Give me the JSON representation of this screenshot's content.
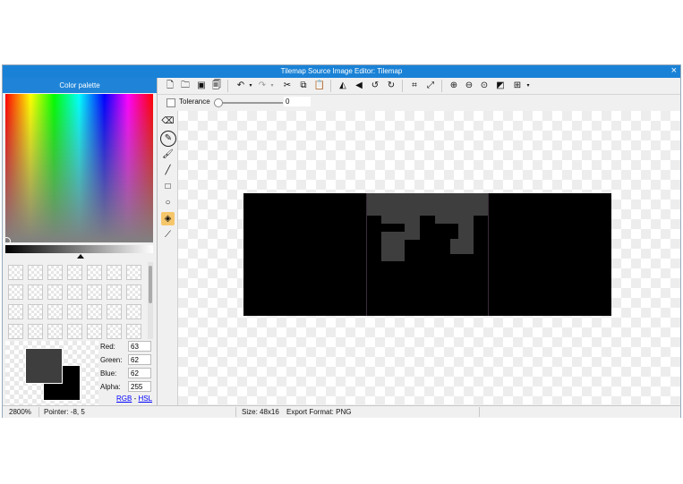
{
  "window": {
    "title": "Tilemap Source Image Editor: Tilemap",
    "close_icon": "×"
  },
  "palette": {
    "header": "Color palette",
    "primary_color": "#3f3e3e",
    "secondary_color": "#000000",
    "swatch_rows": 4,
    "swatch_cols": 7,
    "red_label": "Red:",
    "red": "63",
    "green_label": "Green:",
    "green": "62",
    "blue_label": "Blue:",
    "blue": "62",
    "alpha_label": "Alpha:",
    "alpha": "255",
    "rgb_link": "RGB",
    "link_sep": "-",
    "hsl_link": "HSL"
  },
  "toolbar": {
    "icons": [
      "new-file-icon",
      "open-folder-icon",
      "save-icon",
      "save-as-icon",
      "undo-icon",
      "redo-icon",
      "cut-icon",
      "copy-icon",
      "paste-icon",
      "flip-horizontal-icon",
      "flip-vertical-icon",
      "rotate-left-icon",
      "rotate-right-icon",
      "crop-icon",
      "resize-icon",
      "zoom-in-icon",
      "zoom-out-icon",
      "zoom-fit-icon",
      "toggle-background-icon",
      "grid-icon"
    ]
  },
  "options": {
    "tolerance_label": "Tolerance",
    "tolerance_value": "0"
  },
  "tools": [
    "eraser-icon",
    "pencil-icon",
    "brush-icon",
    "line-icon",
    "rectangle-icon",
    "ellipse-icon",
    "fill-bucket-icon",
    "eyedropper-icon"
  ],
  "status": {
    "zoom": "2800%",
    "pointer": "Pointer: -8, 5",
    "size": "Size: 48x16",
    "export_format": "Export Format: PNG"
  }
}
